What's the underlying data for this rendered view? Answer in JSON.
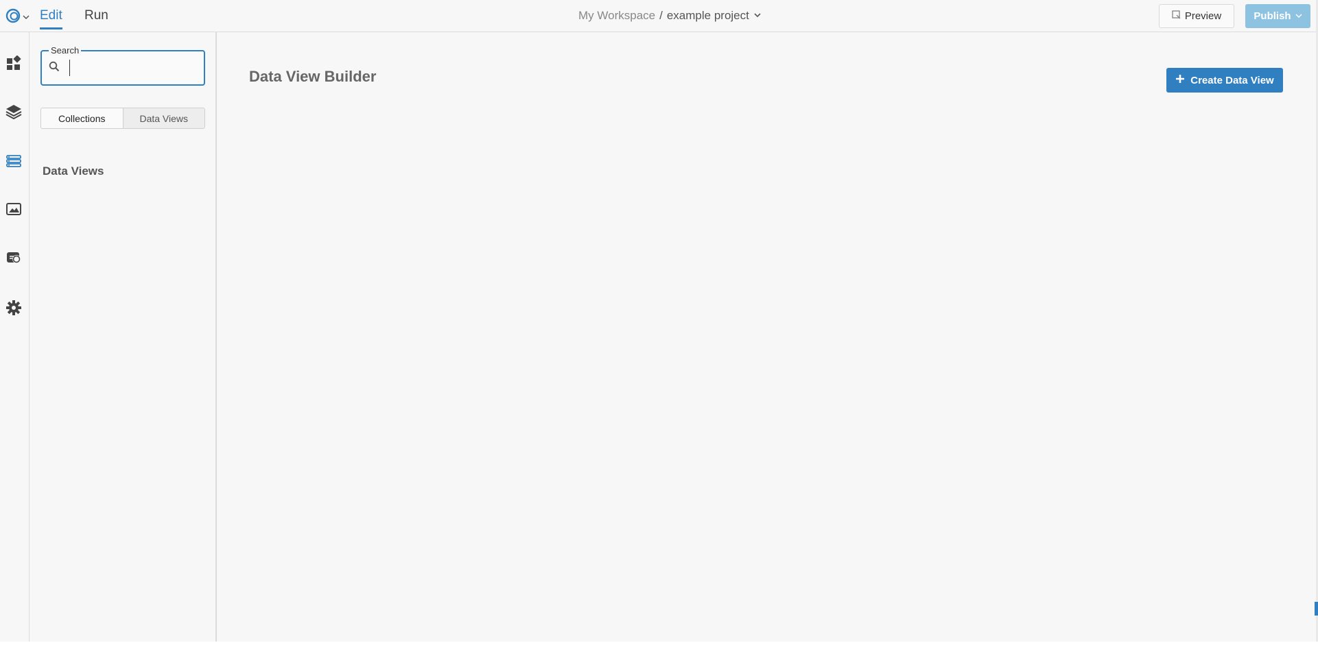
{
  "topbar": {
    "tabs": [
      {
        "label": "Edit",
        "active": true
      },
      {
        "label": "Run",
        "active": false
      }
    ],
    "workspace_name": "My Workspace",
    "separator": "/",
    "project_name": "example project",
    "preview_label": "Preview",
    "publish_label": "Publish"
  },
  "rail": {
    "icons": [
      "dashboard-icon",
      "layers-icon",
      "data-list-icon",
      "image-icon",
      "api-icon",
      "gear-icon"
    ],
    "active_icon": "data-list-icon"
  },
  "sidepanel": {
    "search_label": "Search",
    "search_value": "",
    "segments": [
      {
        "label": "Collections",
        "selected": true
      },
      {
        "label": "Data Views",
        "selected": false
      }
    ],
    "heading": "Data Views"
  },
  "main": {
    "title": "Data View Builder",
    "create_button_label": "Create Data View"
  },
  "colors": {
    "accent": "#2f7fc1",
    "publish_disabled": "#8ec2e1",
    "background": "#f7f7f7"
  }
}
